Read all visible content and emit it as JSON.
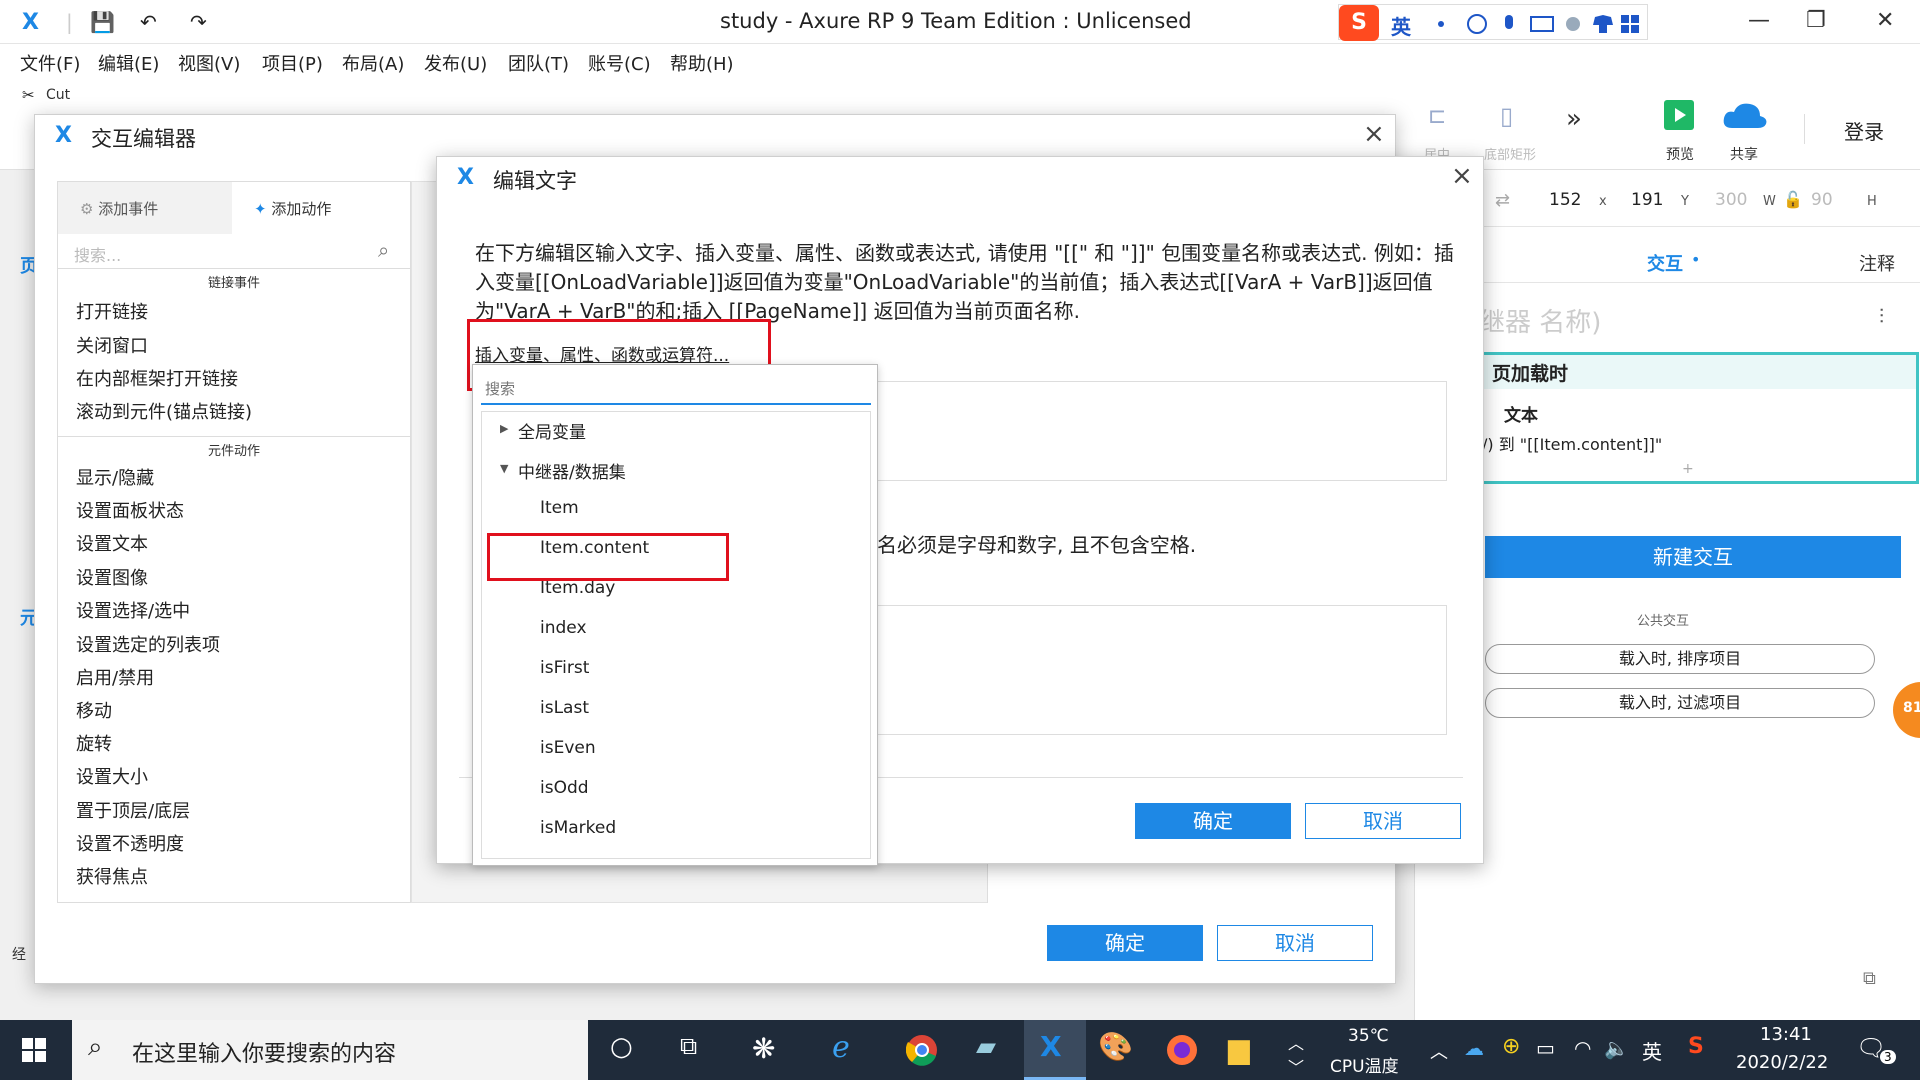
{
  "window": {
    "title": "study - Axure RP 9 Team Edition : Unlicensed",
    "logo_char": "X",
    "minimize": "—",
    "maximize": "❐",
    "close": "✕"
  },
  "ime": {
    "logo": "S",
    "lang": "英"
  },
  "menu": [
    "文件(F)",
    "编辑(E)",
    "视图(V)",
    "项目(P)",
    "布局(A)",
    "发布(U)",
    "团队(T)",
    "账号(C)",
    "帮助(H)"
  ],
  "toolbar": {
    "cut_label": "Cut",
    "preview_label": "预览",
    "share_label": "共享",
    "login_label": "登录",
    "more": "»",
    "faded_a": "居中",
    "faded_b": "底部矩形"
  },
  "inspector": {
    "x": "152",
    "x_lbl": "x",
    "y": "191",
    "y_lbl": "Y",
    "w": "300",
    "w_lbl": "W",
    "h": "90",
    "h_lbl": "H",
    "tab_interact": "交互",
    "tab_notes": "注释",
    "repeater_name": "继器 名称)",
    "event_onload": "页加载时",
    "action_settext": "文本",
    "action_detail": "/) 到 \"[[Item.content]]\"",
    "add_plus": "+",
    "new_interaction": "新建交互",
    "common_label": "公共交互",
    "common_sort": "载入时, 排序项目",
    "common_filter": "载入时, 过滤项目",
    "badge": "81"
  },
  "interaction_editor": {
    "title": "交互编辑器",
    "tab_add_event": "添加事件",
    "tab_add_action": "添加动作",
    "search_placeholder": "搜索...",
    "sec_link": "链接事件",
    "link_items": [
      "打开链接",
      "关闭窗口",
      "在内部框架打开链接",
      "滚动到元件(锚点链接)"
    ],
    "sec_widget": "元件动作",
    "widget_items": [
      "显示/隐藏",
      "设置面板状态",
      "设置文本",
      "设置图像",
      "设置选择/选中",
      "设置选定的列表项",
      "启用/禁用",
      "移动",
      "旋转",
      "设置大小",
      "置于顶层/底层",
      "设置不透明度",
      "获得焦点"
    ],
    "ok": "确定",
    "cancel": "取消"
  },
  "edit_text": {
    "title": "编辑文字",
    "description": "在下方编辑区输入文字、插入变量、属性、函数或表达式, 请使用 \"[[\" 和 \"]]\" 包围变量名称或表达式. 例如：插入变量[[OnLoadVariable]]返回值为变量\"OnLoadVariable\"的当前值；插入表达式[[VarA + VarB]]返回值为\"VarA + VarB\"的和;插入 [[PageName]] 返回值为当前页面名称.",
    "insert_link": "插入变量、属性、函数或运算符...",
    "local_var_note": "名必须是字母和数字, 且不包含空格.",
    "ok": "确定",
    "cancel": "取消"
  },
  "dropdown": {
    "search_placeholder": "搜索",
    "groups": [
      {
        "label": "全局变量",
        "expanded": false
      },
      {
        "label": "中继器/数据集",
        "expanded": true
      }
    ],
    "items": [
      "Item",
      "Item.content",
      "Item.day",
      "index",
      "isFirst",
      "isLast",
      "isEven",
      "isOdd",
      "isMarked"
    ],
    "highlighted": "Item.content"
  },
  "left_peek": {
    "a": "页",
    "b": "元",
    "c": "经"
  },
  "taskbar": {
    "search_text": "在这里输入你要搜索的内容",
    "temp": "35℃",
    "temp_label": "CPU温度",
    "lang": "英",
    "time": "13:41",
    "date": "2020/2/22",
    "notif_count": "3"
  },
  "colors": {
    "accent": "#1e88e5",
    "highlight_box": "#e0101d",
    "taskbar": "#1f2b3a",
    "teal": "#40c4c4"
  }
}
